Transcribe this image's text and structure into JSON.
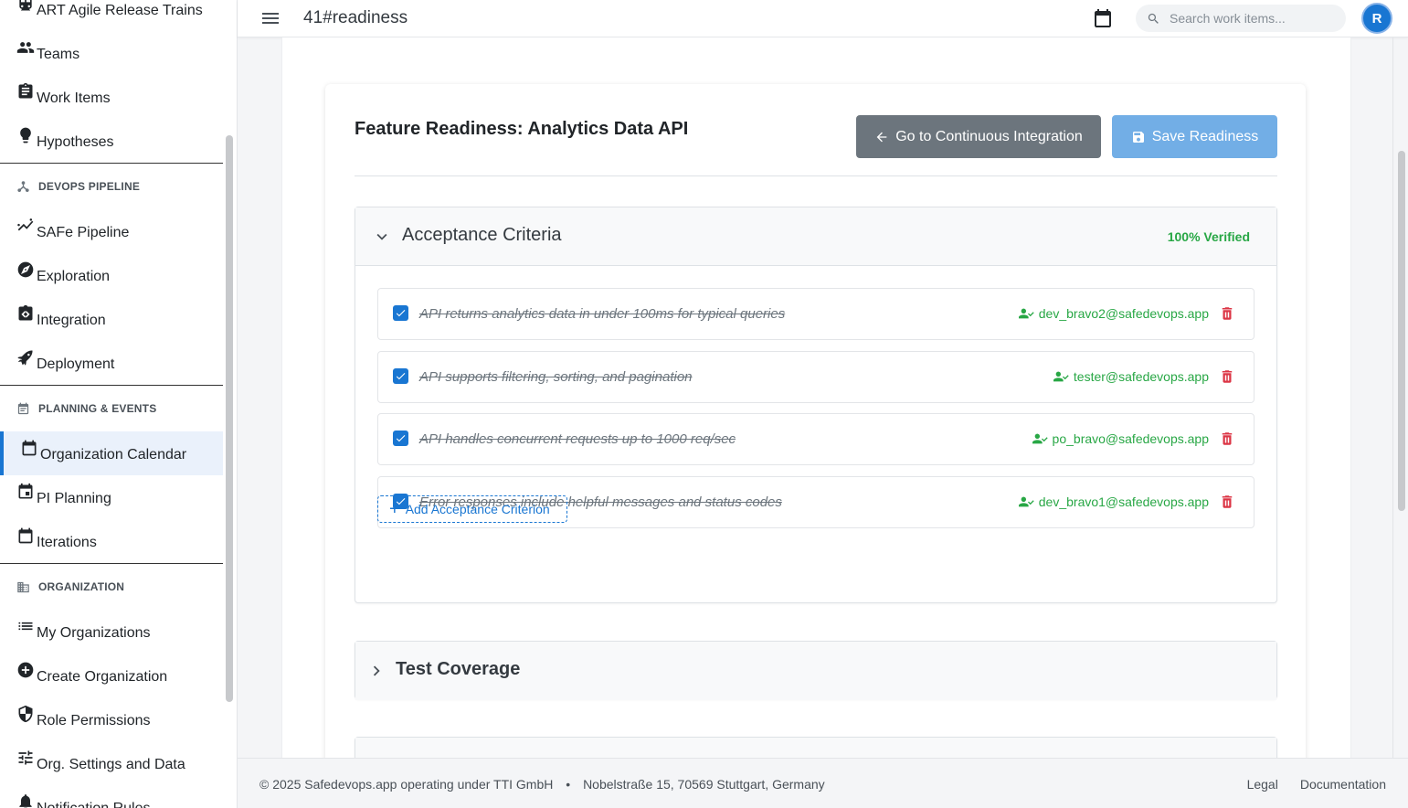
{
  "header": {
    "title": "41#readiness",
    "search_placeholder": "Search work items...",
    "avatar_initial": "R"
  },
  "sidebar": {
    "items_top": [
      {
        "label": "ART Agile Release Trains",
        "icon": "train-icon"
      },
      {
        "label": "Teams",
        "icon": "people-icon"
      },
      {
        "label": "Work Items",
        "icon": "clipboard-icon"
      },
      {
        "label": "Hypotheses",
        "icon": "lightbulb-icon"
      }
    ],
    "sections": [
      {
        "title": "DEVOPS PIPELINE",
        "icon": "pipeline-icon",
        "items": [
          {
            "label": "SAFe Pipeline",
            "icon": "chart-line-icon"
          },
          {
            "label": "Exploration",
            "icon": "compass-icon"
          },
          {
            "label": "Integration",
            "icon": "code-file-icon"
          },
          {
            "label": "Deployment",
            "icon": "rocket-icon"
          }
        ]
      },
      {
        "title": "PLANNING & EVENTS",
        "icon": "event-note-icon",
        "items": [
          {
            "label": "Organization Calendar",
            "icon": "calendar-icon",
            "active": true
          },
          {
            "label": "PI Planning",
            "icon": "calendar-event-icon"
          },
          {
            "label": "Iterations",
            "icon": "calendar-blank-icon"
          }
        ]
      },
      {
        "title": "ORGANIZATION",
        "icon": "building-icon",
        "items": [
          {
            "label": "My Organizations",
            "icon": "list-icon"
          },
          {
            "label": "Create Organization",
            "icon": "plus-circle-icon"
          },
          {
            "label": "Role Permissions",
            "icon": "shield-icon"
          },
          {
            "label": "Org. Settings and Data",
            "icon": "tune-icon"
          },
          {
            "label": "Notification Rules",
            "icon": "bell-icon"
          }
        ]
      }
    ]
  },
  "card": {
    "title": "Feature Readiness: Analytics Data API",
    "ci_button": "Go to Continuous Integration",
    "save_button": "Save Readiness"
  },
  "acceptance": {
    "title": "Acceptance Criteria",
    "status": "100% Verified",
    "criteria": [
      {
        "text": "API returns analytics data in under 100ms for typical queries",
        "assignee": "dev_bravo2@safedevops.app",
        "checked": true
      },
      {
        "text": "API supports filtering, sorting, and pagination",
        "assignee": "tester@safedevops.app",
        "checked": true
      },
      {
        "text": "API handles concurrent requests up to 1000 req/sec",
        "assignee": "po_bravo@safedevops.app",
        "checked": true
      },
      {
        "text": "Error responses include helpful messages and status codes",
        "assignee": "dev_bravo1@safedevops.app",
        "checked": true
      }
    ],
    "add_label": "Add Acceptance Criterion"
  },
  "test_coverage": {
    "title": "Test Coverage"
  },
  "footer": {
    "copyright": "© 2025 Safedevops.app operating under TTI GmbH",
    "separator": "•",
    "address": "Nobelstraße 15, 70569 Stuttgart, Germany",
    "legal": "Legal",
    "docs": "Documentation"
  },
  "colors": {
    "primary": "#1976d2",
    "success": "#28a745",
    "danger": "#dc3545",
    "secondary": "#6c757d"
  }
}
